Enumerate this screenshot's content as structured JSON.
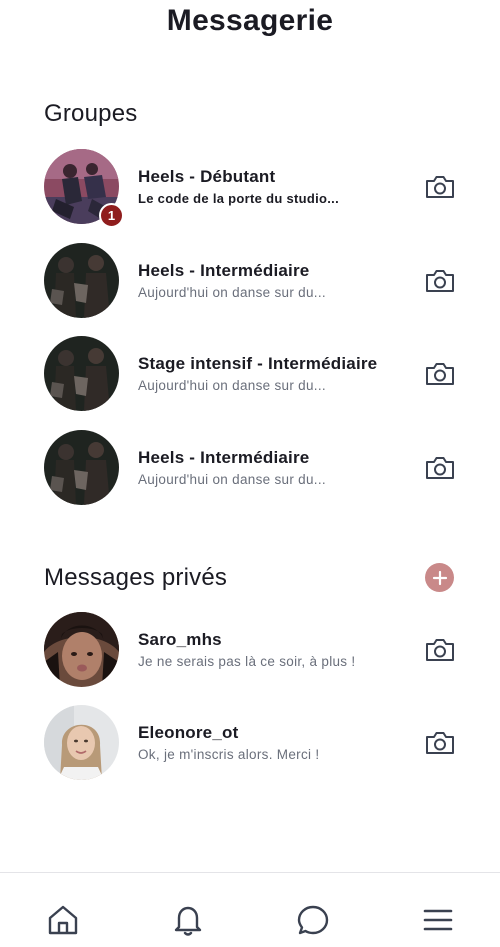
{
  "header": {
    "title": "Messagerie"
  },
  "groups": {
    "title": "Groupes",
    "items": [
      {
        "name": "Heels - Débutant",
        "preview": "Le code de la porte du studio...",
        "unread": "1",
        "avatar": "group-photo"
      },
      {
        "name": "Heels - Intermédiaire",
        "preview": "Aujourd'hui on danse sur du...",
        "avatar": "group-photo"
      },
      {
        "name": "Stage intensif - Intermédiaire",
        "preview": "Aujourd'hui on danse sur du...",
        "avatar": "group-photo"
      },
      {
        "name": "Heels - Intermédiaire",
        "preview": "Aujourd'hui on danse sur du...",
        "avatar": "group-photo"
      }
    ]
  },
  "private": {
    "title": "Messages privés",
    "add_icon": "plus-circle-icon",
    "items": [
      {
        "name": "Saro_mhs",
        "preview": "Je ne serais pas là ce soir, à plus !",
        "avatar": "user-photo"
      },
      {
        "name": "Eleonore_ot",
        "preview": "Ok, je m'inscris alors. Merci !",
        "avatar": "user-photo"
      }
    ]
  },
  "row_action_icon": "camera-icon",
  "tabbar": {
    "items": [
      {
        "icon": "home-icon"
      },
      {
        "icon": "bell-icon"
      },
      {
        "icon": "chat-icon"
      },
      {
        "icon": "menu-icon"
      }
    ]
  },
  "colors": {
    "text": "#1b1b23",
    "muted": "#6a6f7b",
    "accent": "#c98989",
    "badge": "#8f1d1d",
    "icon": "#3a4150"
  }
}
